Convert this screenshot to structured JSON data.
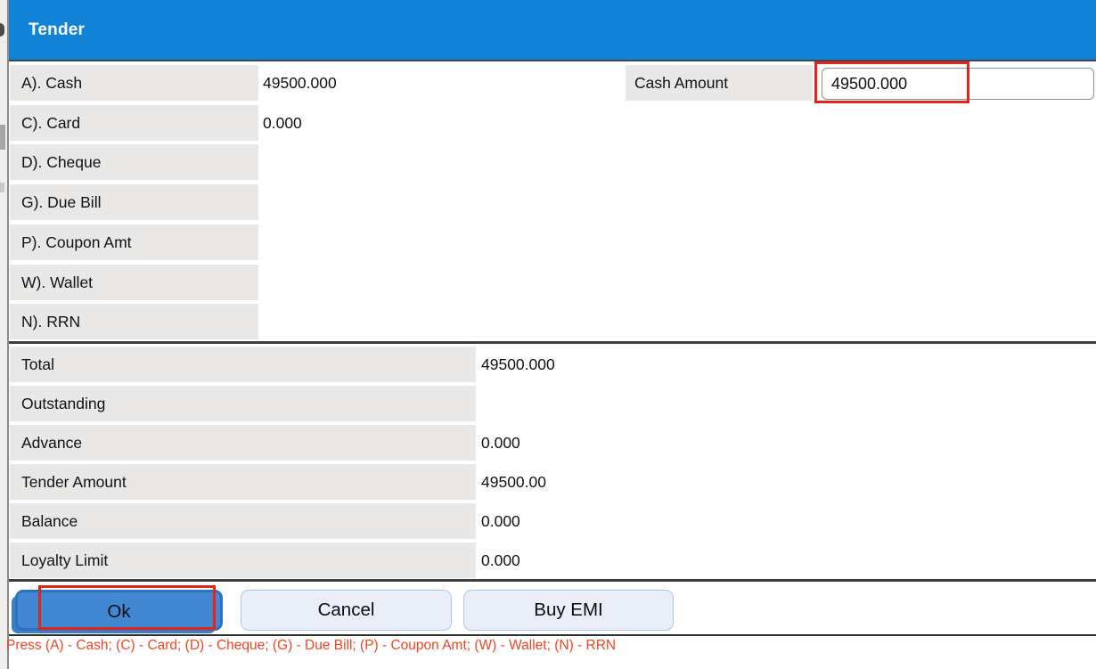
{
  "dialog": {
    "title": "Tender"
  },
  "tender_rows": [
    {
      "label": "A). Cash",
      "value": "49500.000"
    },
    {
      "label": "C). Card",
      "value": "0.000"
    },
    {
      "label": "D). Cheque",
      "value": ""
    },
    {
      "label": "G). Due Bill",
      "value": ""
    },
    {
      "label": "P). Coupon Amt",
      "value": ""
    },
    {
      "label": "W). Wallet",
      "value": ""
    },
    {
      "label": "N). RRN",
      "value": ""
    }
  ],
  "cash_amount": {
    "label": "Cash Amount",
    "value": "49500.000"
  },
  "summary_rows": [
    {
      "label": "Total",
      "value": "49500.000"
    },
    {
      "label": "Outstanding",
      "value": ""
    },
    {
      "label": "Advance",
      "value": "0.000"
    },
    {
      "label": "Tender Amount",
      "value": "49500.00"
    },
    {
      "label": "Balance",
      "value": "0.000"
    },
    {
      "label": "Loyalty Limit",
      "value": "0.000"
    }
  ],
  "buttons": {
    "ok": "Ok",
    "cancel": "Cancel",
    "buy_emi": "Buy EMI"
  },
  "footer_hint": "Press (A) - Cash; (C) - Card; (D) - Cheque; (G) - Due Bill; (P) - Coupon Amt; (W) - Wallet; (N) - RRN",
  "colors": {
    "header_blue": "#1083d6",
    "cell_gray": "#e9e8e6",
    "ok_button_blue": "#4187d2",
    "ok_button_border": "#2e71bd",
    "secondary_button_bg": "#e9eef9",
    "annotation_red": "#e0251a",
    "hint_red": "#f4431f"
  }
}
